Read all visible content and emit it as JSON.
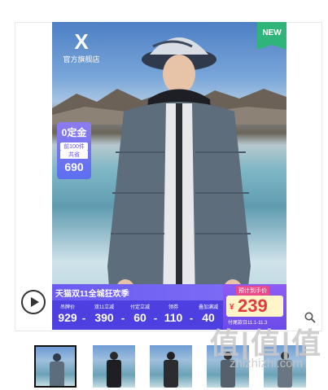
{
  "product": {
    "new_badge": "NEW",
    "brand": {
      "mark": "X",
      "name": "官方旗舰店"
    },
    "deposit": {
      "title": "0定金",
      "line1": "前100件",
      "line2": "共省",
      "amount": "690"
    },
    "promo": {
      "title": "天猫双11全城狂欢季",
      "cells": [
        {
          "label": "吊牌价",
          "value": "929"
        },
        {
          "label": "双11立减",
          "value": "390"
        },
        {
          "label": "付定立减",
          "value": "60"
        },
        {
          "label": "领券",
          "value": "110"
        },
        {
          "label": "叠加满减",
          "value": "40"
        }
      ],
      "separator": "-"
    },
    "price": {
      "label": "预计到手价",
      "currency": "¥",
      "value": "239",
      "date": "付尾款日11.1-11.3"
    }
  },
  "icons": {
    "play": "play-icon",
    "zoom": "magnifier-icon"
  },
  "thumbnails": [
    {
      "name": "thumb-1",
      "selected": true
    },
    {
      "name": "thumb-2",
      "selected": false
    },
    {
      "name": "thumb-3",
      "selected": false
    },
    {
      "name": "thumb-4",
      "selected": false
    },
    {
      "name": "thumb-5",
      "selected": false
    }
  ],
  "watermark": {
    "big": "值|值|值",
    "small": "zhizhizhi.com"
  },
  "colors": {
    "accent": "#6a5cf2",
    "price": "#e23b3b",
    "new": "#2fb57a"
  }
}
